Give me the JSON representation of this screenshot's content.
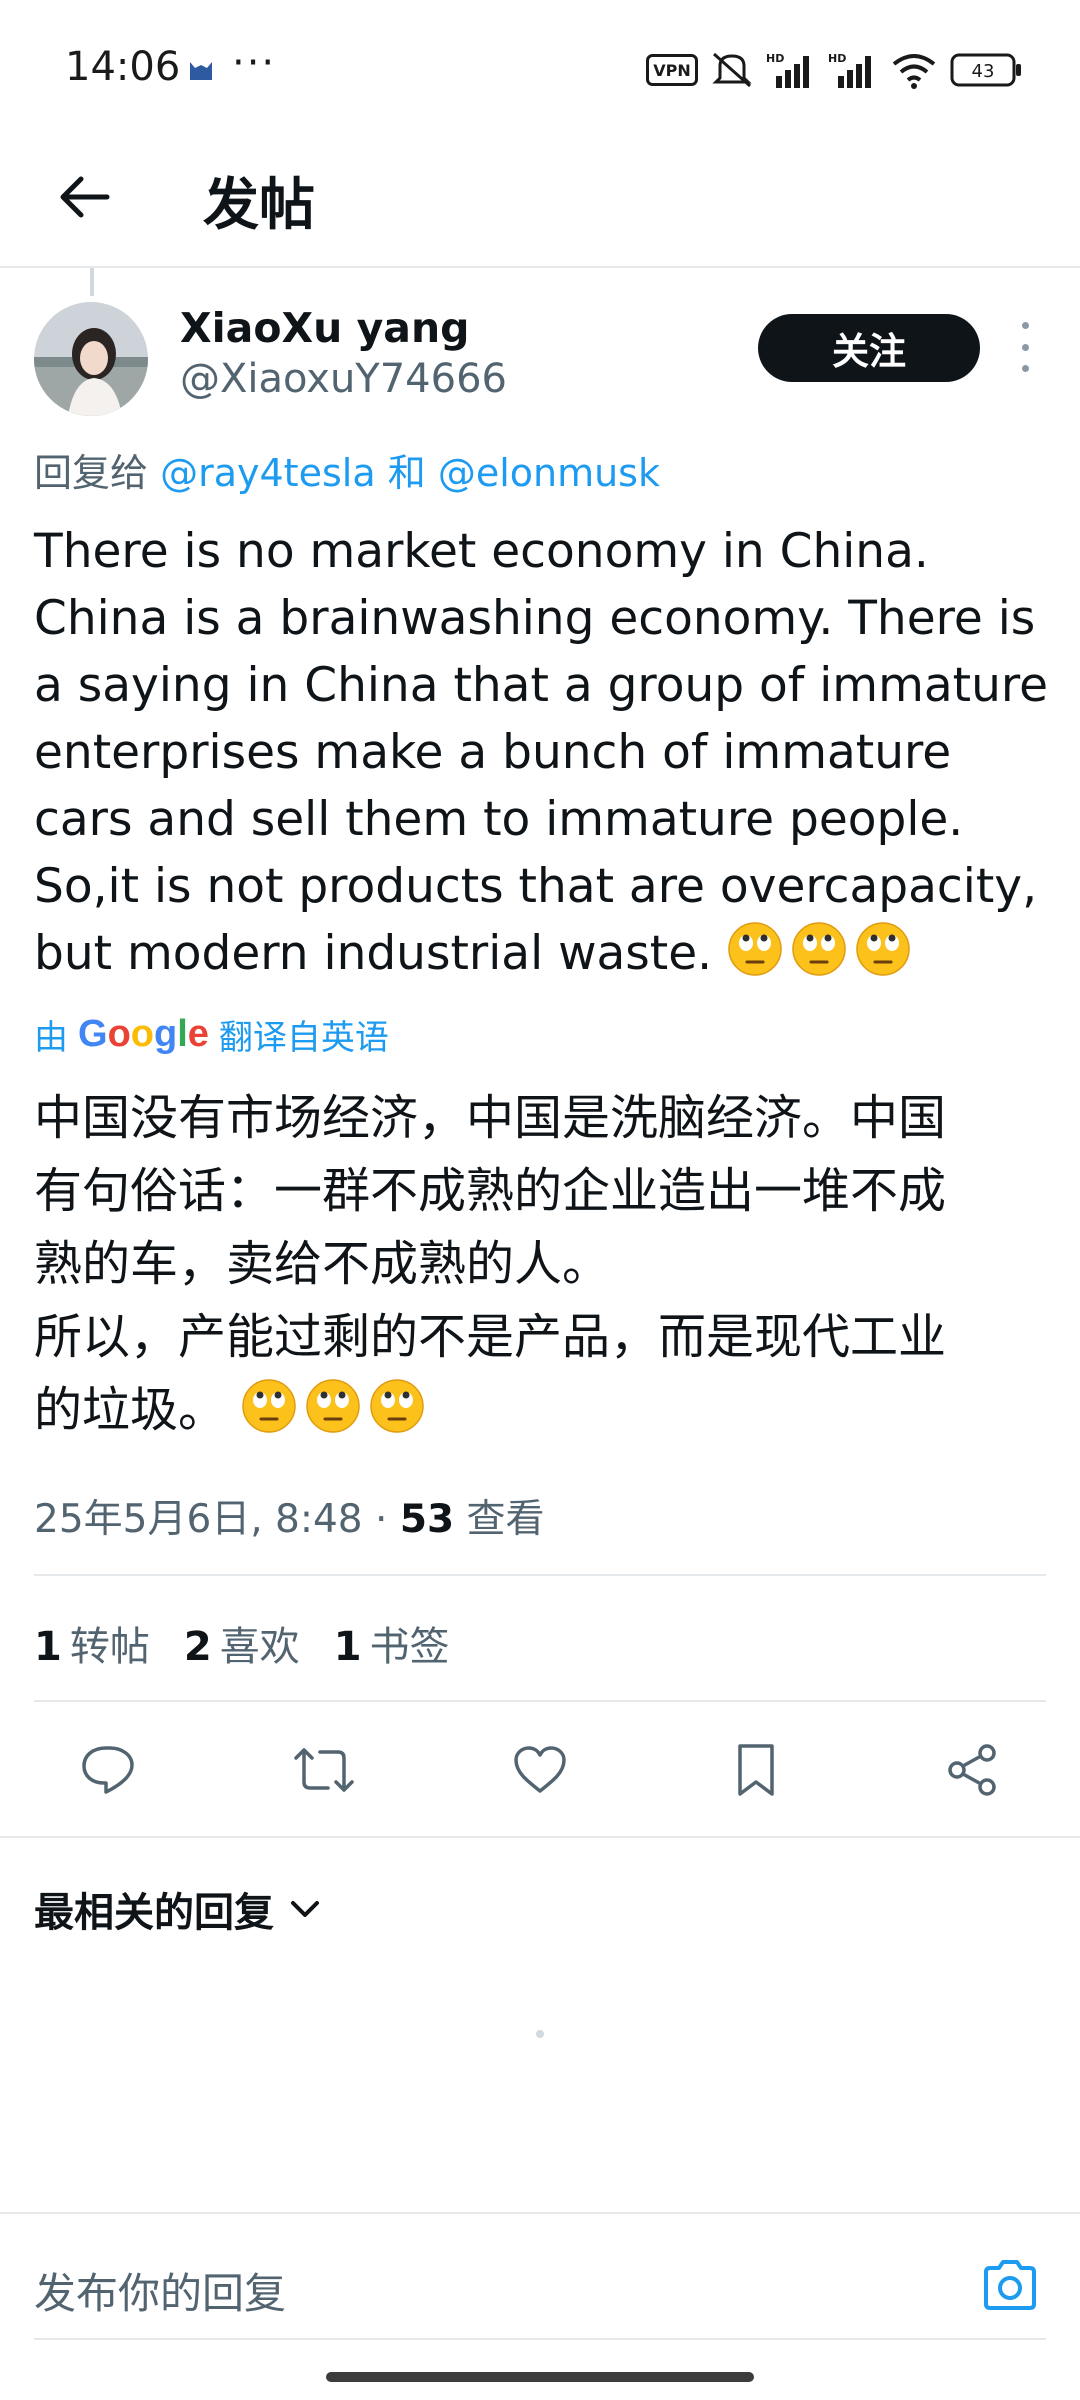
{
  "status_bar": {
    "time": "14:06",
    "dots": "···",
    "vpn": "VPN",
    "hd1": "HD",
    "hd2": "HD",
    "battery": "43"
  },
  "header": {
    "title": "发帖"
  },
  "tweet": {
    "author_name": "XiaoXu yang",
    "author_handle": "@XiaoxuY74666",
    "follow_label": "关注",
    "reply_prefix": "回复给",
    "mention_1": "@ray4tesla",
    "reply_and": "和",
    "mention_2": "@elonmusk",
    "text_lines": [
      "There is no market economy in China.",
      "China is a brainwashing economy. There is",
      "a saying in China that a group of immature",
      "enterprises make a bunch of immature",
      "cars and sell them to immature people.",
      "So,it is not products that are overcapacity,",
      "but modern industrial waste."
    ],
    "translated_prefix": "由",
    "translated_suffix": "翻译自英语",
    "google": {
      "g1": "G",
      "o1": "o",
      "o2": "o",
      "g2": "g",
      "l": "l",
      "e": "e"
    },
    "translated_lines": [
      "中国没有市场经济，中国是洗脑经济。中国",
      "有句俗话：一群不成熟的企业造出一堆不成",
      "熟的车，卖给不成熟的人。",
      "所以，产能过剩的不是产品，而是现代工业",
      "的垃圾。"
    ],
    "timestamp": "25年5月6日, 8:48",
    "separator": "·",
    "views_count": "53",
    "views_label": "查看",
    "stats": {
      "reposts_count": "1",
      "reposts_label": "转帖",
      "likes_count": "2",
      "likes_label": "喜欢",
      "bookmarks_count": "1",
      "bookmarks_label": "书签"
    }
  },
  "replies": {
    "sort_label": "最相关的回复"
  },
  "compose": {
    "placeholder": "发布你的回复"
  },
  "icons": {
    "back": "arrow-left",
    "reply": "speech-bubble",
    "repost": "repost-arrows",
    "like": "heart",
    "bookmark": "bookmark",
    "share": "share-nodes",
    "camera": "camera",
    "emoji": "face-with-rolling-eyes"
  },
  "colors": {
    "link": "#1d9bf0",
    "follow_bg": "#0f1419",
    "secondary_text": "#536471",
    "icon": "#536471"
  }
}
